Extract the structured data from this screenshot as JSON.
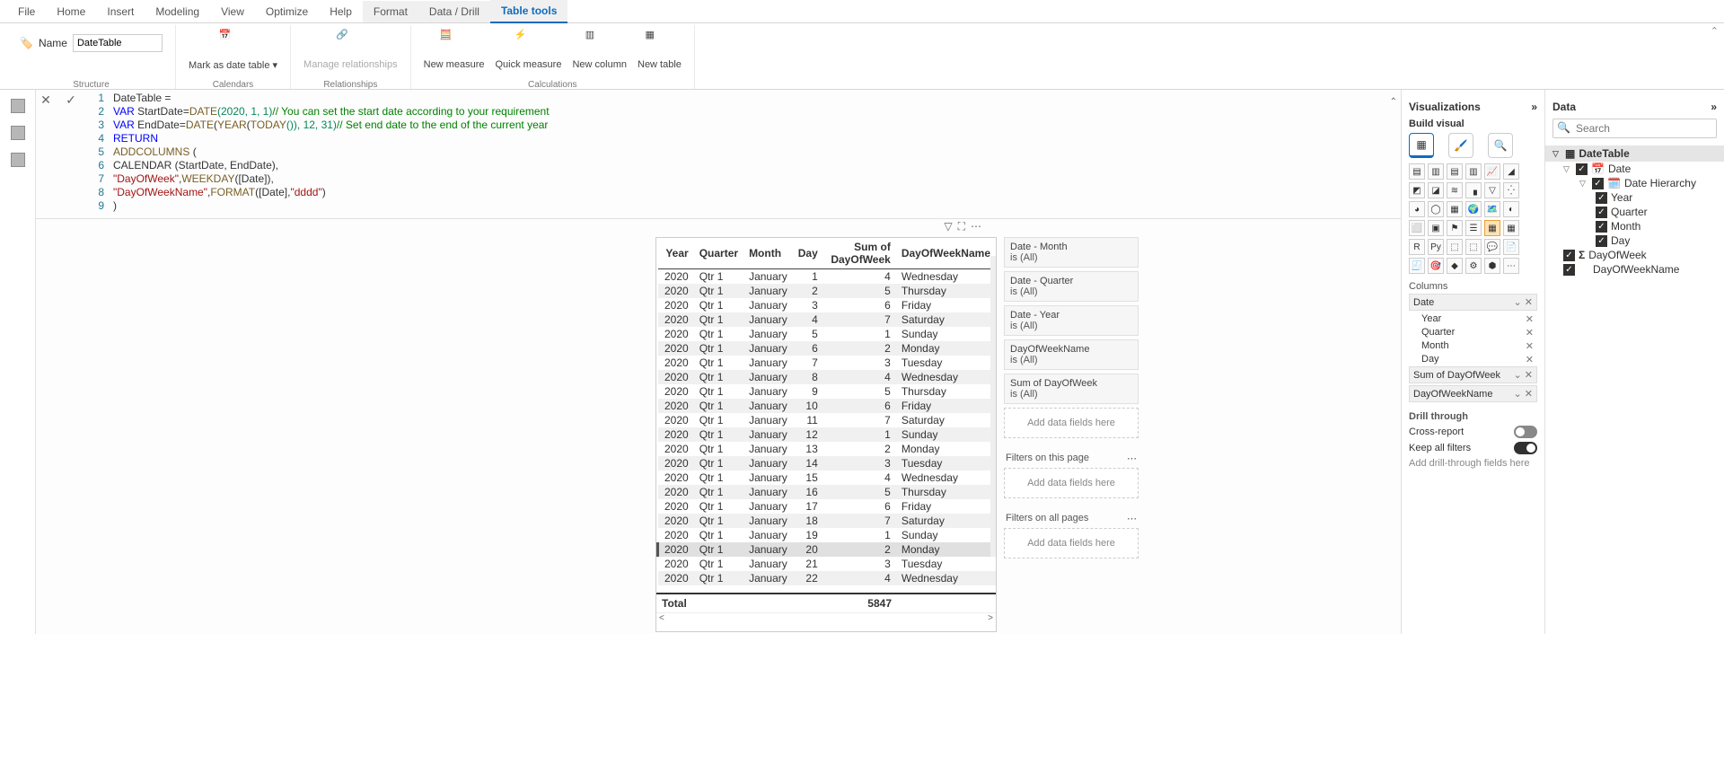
{
  "tabs": {
    "file": "File",
    "home": "Home",
    "insert": "Insert",
    "modeling": "Modeling",
    "view": "View",
    "optimize": "Optimize",
    "help": "Help",
    "format": "Format",
    "datadrill": "Data / Drill",
    "tabletools": "Table tools"
  },
  "ribbon": {
    "name_label": "Name",
    "name_value": "DateTable",
    "structure_group": "Structure",
    "mark_as_date": "Mark as date table ▾",
    "calendars_group": "Calendars",
    "manage_rel": "Manage relationships",
    "relationships_group": "Relationships",
    "new_measure": "New measure",
    "quick_measure": "Quick measure",
    "new_column": "New column",
    "new_table": "New table",
    "calculations_group": "Calculations"
  },
  "formula": {
    "l1": "DateTable =",
    "l2_var": "VAR",
    "l2_name": "StartDate",
    "l2_eq": " = ",
    "l2_fn": "DATE",
    "l2_args": "(2020, 1, 1)",
    "l2_c": " // You can set the start date according to your requirement",
    "l3_var": "VAR",
    "l3_name": "EndDate",
    "l3_eq": " = ",
    "l3_fn": "DATE",
    "l3_in": "(",
    "l3_fn2": "YEAR",
    "l3_in2": "(",
    "l3_fn3": "TODAY",
    "l3_in3": "()), 12, 31)",
    "l3_c": " // Set end date to the end of the current year",
    "l4": "RETURN",
    "l5": "    ADDCOLUMNS",
    "l5b": "(",
    "l6": "        CALENDAR (StartDate, EndDate),",
    "l7a": "        ",
    "l7s": "\"DayOfWeek\"",
    "l7b": ", ",
    "l7fn": "WEEKDAY",
    "l7c": "([Date]),",
    "l8a": "        ",
    "l8s": "\"DayOfWeekName\"",
    "l8b": ", ",
    "l8fn": "FORMAT",
    "l8c": "([Date], ",
    "l8s2": "\"dddd\"",
    "l8d": ")",
    "l9": "    )"
  },
  "chart_data": {
    "type": "table",
    "columns": [
      "Year",
      "Quarter",
      "Month",
      "Day",
      "Sum of DayOfWeek",
      "DayOfWeekName"
    ],
    "rows": [
      [
        2020,
        "Qtr 1",
        "January",
        1,
        4,
        "Wednesday"
      ],
      [
        2020,
        "Qtr 1",
        "January",
        2,
        5,
        "Thursday"
      ],
      [
        2020,
        "Qtr 1",
        "January",
        3,
        6,
        "Friday"
      ],
      [
        2020,
        "Qtr 1",
        "January",
        4,
        7,
        "Saturday"
      ],
      [
        2020,
        "Qtr 1",
        "January",
        5,
        1,
        "Sunday"
      ],
      [
        2020,
        "Qtr 1",
        "January",
        6,
        2,
        "Monday"
      ],
      [
        2020,
        "Qtr 1",
        "January",
        7,
        3,
        "Tuesday"
      ],
      [
        2020,
        "Qtr 1",
        "January",
        8,
        4,
        "Wednesday"
      ],
      [
        2020,
        "Qtr 1",
        "January",
        9,
        5,
        "Thursday"
      ],
      [
        2020,
        "Qtr 1",
        "January",
        10,
        6,
        "Friday"
      ],
      [
        2020,
        "Qtr 1",
        "January",
        11,
        7,
        "Saturday"
      ],
      [
        2020,
        "Qtr 1",
        "January",
        12,
        1,
        "Sunday"
      ],
      [
        2020,
        "Qtr 1",
        "January",
        13,
        2,
        "Monday"
      ],
      [
        2020,
        "Qtr 1",
        "January",
        14,
        3,
        "Tuesday"
      ],
      [
        2020,
        "Qtr 1",
        "January",
        15,
        4,
        "Wednesday"
      ],
      [
        2020,
        "Qtr 1",
        "January",
        16,
        5,
        "Thursday"
      ],
      [
        2020,
        "Qtr 1",
        "January",
        17,
        6,
        "Friday"
      ],
      [
        2020,
        "Qtr 1",
        "January",
        18,
        7,
        "Saturday"
      ],
      [
        2020,
        "Qtr 1",
        "January",
        19,
        1,
        "Sunday"
      ],
      [
        2020,
        "Qtr 1",
        "January",
        20,
        2,
        "Monday"
      ],
      [
        2020,
        "Qtr 1",
        "January",
        21,
        3,
        "Tuesday"
      ],
      [
        2020,
        "Qtr 1",
        "January",
        22,
        4,
        "Wednesday"
      ]
    ],
    "selected_row_index": 19,
    "total_label": "Total",
    "total_value": "5847"
  },
  "filters": {
    "visual": [
      {
        "title": "Date - Month",
        "value": "is (All)"
      },
      {
        "title": "Date - Quarter",
        "value": "is (All)"
      },
      {
        "title": "Date - Year",
        "value": "is (All)"
      },
      {
        "title": "DayOfWeekName",
        "value": "is (All)"
      },
      {
        "title": "Sum of DayOfWeek",
        "value": "is (All)"
      }
    ],
    "add_here": "Add data fields here",
    "on_page": "Filters on this page",
    "on_all": "Filters on all pages"
  },
  "vis": {
    "title": "Visualizations",
    "build": "Build visual",
    "columns_label": "Columns",
    "well_date": "Date",
    "well_year": "Year",
    "well_quarter": "Quarter",
    "well_month": "Month",
    "well_day": "Day",
    "well_sum": "Sum of DayOfWeek",
    "well_dow": "DayOfWeekName",
    "drill": "Drill through",
    "cross": "Cross-report",
    "cross_state": "Off",
    "keep": "Keep all filters",
    "keep_state": "On",
    "drill_ph": "Add drill-through fields here"
  },
  "data": {
    "title": "Data",
    "search_ph": "Search",
    "table": "DateTable",
    "field_date": "Date",
    "field_hier": "Date Hierarchy",
    "h_year": "Year",
    "h_quarter": "Quarter",
    "h_month": "Month",
    "h_day": "Day",
    "field_dow": "DayOfWeek",
    "field_down": "DayOfWeekName"
  }
}
